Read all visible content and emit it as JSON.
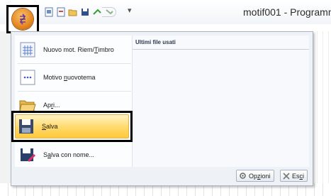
{
  "titlebar": {
    "title": "motif001 - Programm"
  },
  "menu": {
    "items": [
      {
        "label_pre": "Nuovo mot. Riem/",
        "label_u": "T",
        "label_post": "imbro",
        "icon": "new-embroidery-icon"
      },
      {
        "label_pre": "Motivo ",
        "label_u": "n",
        "label_post": "uovotema",
        "icon": "new-pattern-icon"
      },
      {
        "label_pre": "Ap",
        "label_u": "r",
        "label_post": "i...",
        "icon": "folder-open-icon"
      },
      {
        "label_pre": "",
        "label_u": "S",
        "label_post": "alva",
        "icon": "save-icon"
      },
      {
        "label_pre": "S",
        "label_u": "a",
        "label_post": "lva con nome...",
        "icon": "save-as-icon"
      }
    ],
    "recent_header": "Ultimi file usati",
    "footer": {
      "options_pre": "Op",
      "options_u": "z",
      "options_post": "ioni",
      "exit_pre": "Es",
      "exit_u": "c",
      "exit_post": "i"
    }
  },
  "colors": {
    "highlight": "#ffd96a",
    "menu_bg": "#eef1f6",
    "app_button": "#e78b25"
  }
}
